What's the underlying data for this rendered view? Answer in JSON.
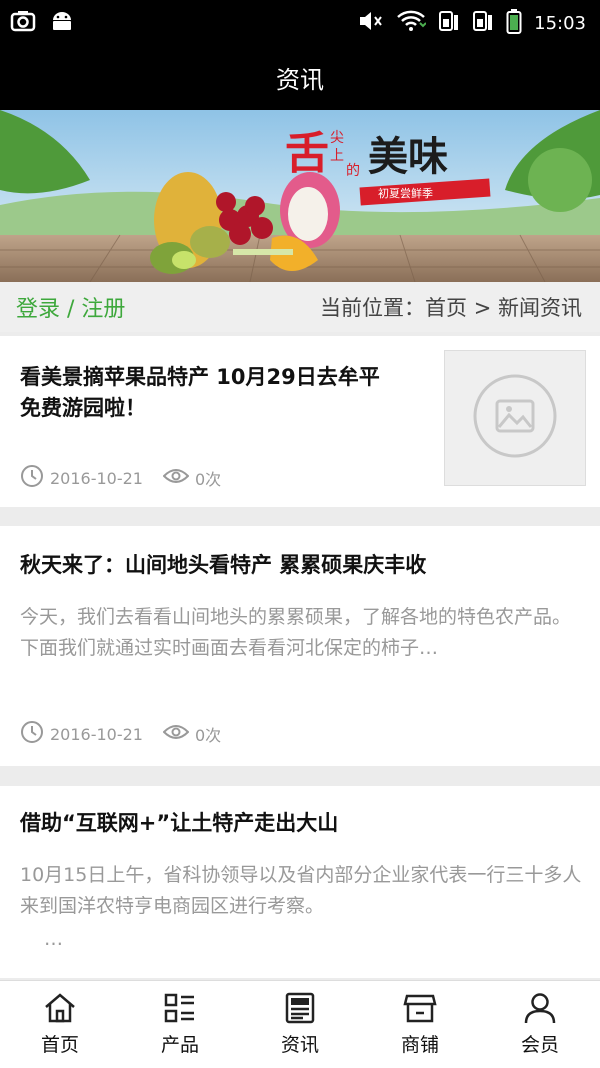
{
  "statusbar": {
    "time": "15:03"
  },
  "header": {
    "title": "资讯"
  },
  "banner": {
    "headline_main": "舌尖上的美味",
    "subline": "初夏尝鲜季"
  },
  "crumbbar": {
    "login_label": "登录 / 注册",
    "location_prefix": "当前位置：",
    "home": "首页",
    "separator": " > ",
    "current": "新闻资讯"
  },
  "articles": [
    {
      "title": "看美景摘苹果品特产 10月29日去牟平免费游园啦！",
      "date": "2016-10-21",
      "views": "0次"
    },
    {
      "title": "秋天来了：山间地头看特产 累累硕果庆丰收",
      "summary": "今天，我们去看看山间地头的累累硕果，了解各地的特色农产品。下面我们就通过实时画面去看看河北保定的柿子…",
      "date": "2016-10-21",
      "views": "0次"
    },
    {
      "title": "借助“互联网+”让土特产走出大山",
      "summary": "10月15日上午，省科协领导以及省内部分企业家代表一行三十多人来到国洋农特亨电商园区进行考察。",
      "ellipsis": "…"
    }
  ],
  "tabs": [
    {
      "label": "首页",
      "icon": "home-icon"
    },
    {
      "label": "产品",
      "icon": "grid-list-icon"
    },
    {
      "label": "资讯",
      "icon": "newspaper-icon"
    },
    {
      "label": "商铺",
      "icon": "store-icon"
    },
    {
      "label": "会员",
      "icon": "user-icon"
    }
  ],
  "colors": {
    "accent_green": "#3ea83c",
    "bar_black": "#000000"
  }
}
